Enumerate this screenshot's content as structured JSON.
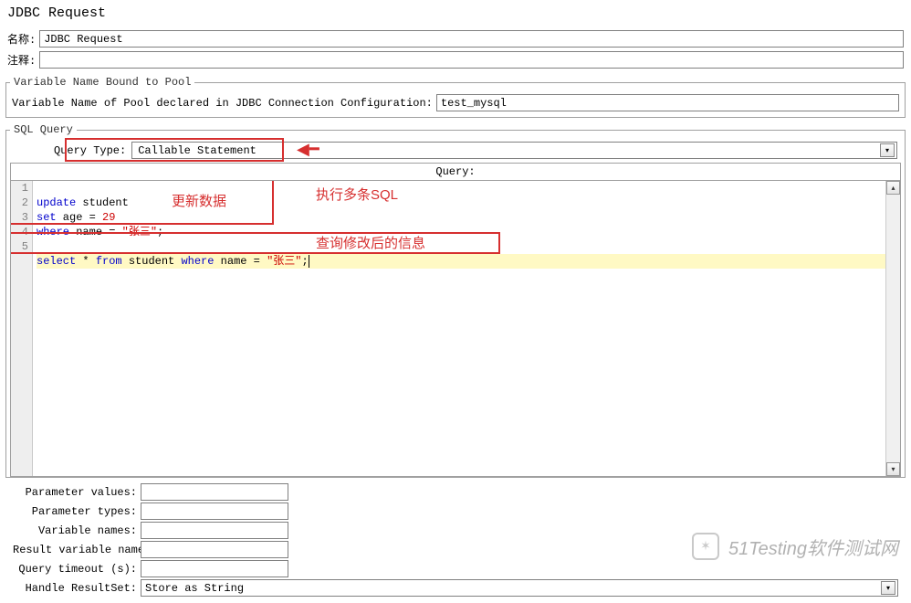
{
  "title": "JDBC Request",
  "labels": {
    "name": "名称:",
    "comment": "注释:"
  },
  "name_value": "JDBC Request",
  "comment_value": "",
  "fieldset_pool": {
    "legend": "Variable Name Bound to Pool",
    "label": "Variable Name of Pool declared in JDBC Connection Configuration:",
    "value": "test_mysql"
  },
  "fieldset_sql": {
    "legend": "SQL Query",
    "query_type_label": "Query Type:",
    "query_type_value": "Callable Statement",
    "query_label": "Query:"
  },
  "code_lines": {
    "l1": {
      "n": "1"
    },
    "l2": {
      "n": "2"
    },
    "l3": {
      "n": "3"
    },
    "l4": {
      "n": "4"
    },
    "l5": {
      "n": "5"
    }
  },
  "annotations": {
    "update": "更新数据",
    "multi": "执行多条SQL",
    "after": "查询修改后的信息"
  },
  "form": {
    "param_values": "Parameter values:",
    "param_types": "Parameter types:",
    "var_names": "Variable names:",
    "result_var": "Result variable name:",
    "timeout": "Query timeout (s):",
    "handle_rs": "Handle ResultSet:",
    "handle_rs_value": "Store as String"
  },
  "watermark": "51Testing软件测试网"
}
